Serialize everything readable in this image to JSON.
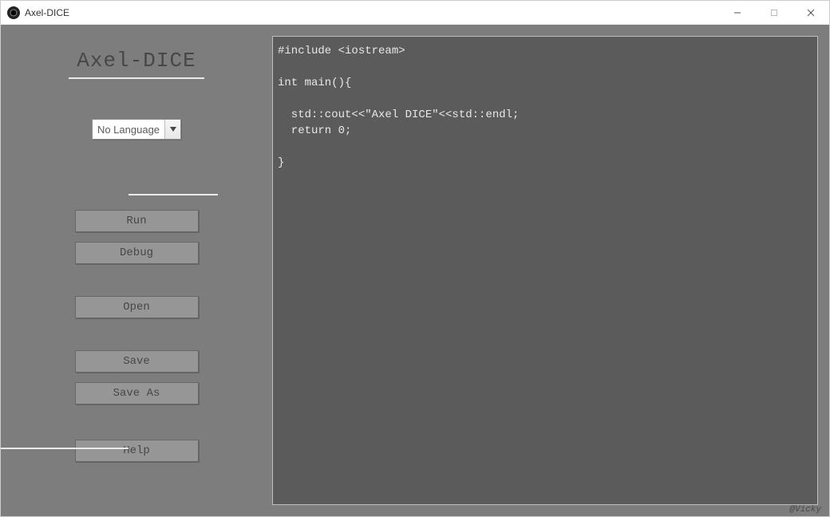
{
  "window": {
    "title": "Axel-DICE"
  },
  "sidebar": {
    "app_title": "Axel-DICE",
    "language_selected": "No Language",
    "buttons": {
      "run": "Run",
      "debug": "Debug",
      "open": "Open",
      "save": "Save",
      "save_as": "Save As",
      "help": "Help"
    }
  },
  "editor": {
    "content": "#include <iostream>\n\nint main(){\n\n  std::cout<<\"Axel DICE\"<<std::endl;\n  return 0;\n\n}"
  },
  "footer": {
    "credit": "@Vicky"
  }
}
